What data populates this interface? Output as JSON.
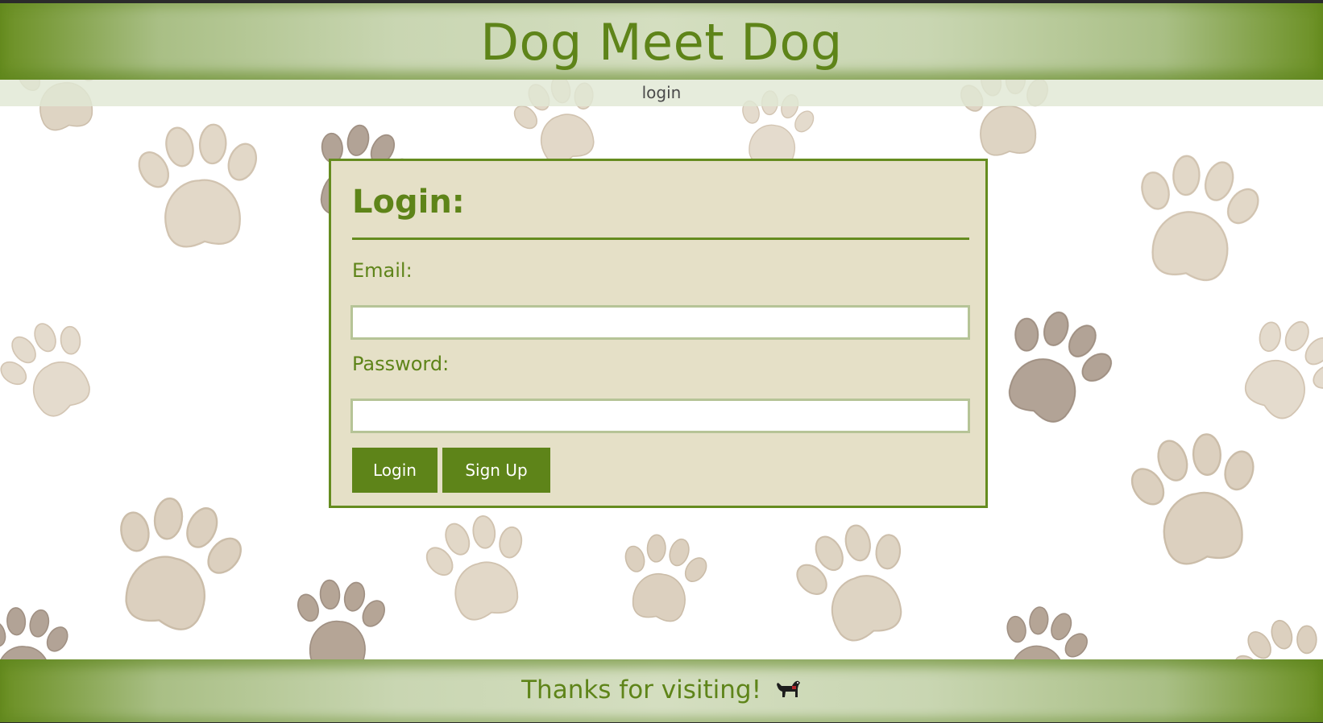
{
  "header": {
    "title": "Dog Meet Dog"
  },
  "nav": {
    "items": [
      {
        "label": "login"
      }
    ]
  },
  "login_form": {
    "heading": "Login:",
    "email_label": "Email:",
    "email_value": "",
    "password_label": "Password:",
    "password_value": "",
    "login_button": "Login",
    "signup_button": "Sign Up"
  },
  "footer": {
    "text": "Thanks for visiting!",
    "icon": "dog-icon"
  },
  "background": {
    "pattern": "paw-print-icon"
  },
  "colors": {
    "accent": "#5e8419",
    "card_background": "#e5e0c7",
    "paw_light": "#d9cdb9",
    "paw_dark": "#a89584"
  }
}
